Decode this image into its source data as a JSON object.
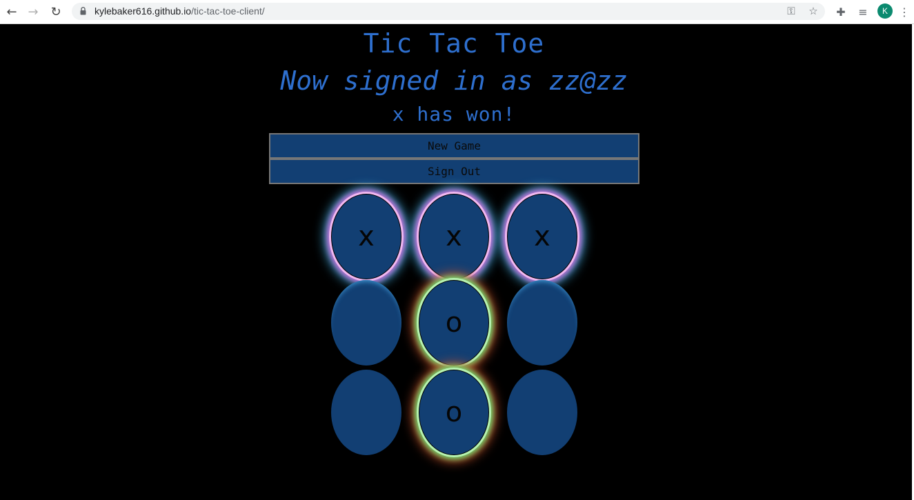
{
  "browser": {
    "url_host": "kylebaker616.github.io",
    "url_path": "/tic-tac-toe-client/",
    "avatar_letter": "K",
    "icons": [
      "back-icon",
      "forward-icon",
      "reload-icon",
      "lock-icon",
      "key-icon",
      "star-icon",
      "extensions-icon",
      "media-icon",
      "menu-icon"
    ]
  },
  "page": {
    "title": "Tic Tac Toe",
    "signed_in_text": "Now signed in as zz@zz",
    "status_text": "x has won!",
    "new_game_label": "New Game",
    "sign_out_label": "Sign Out"
  },
  "board": {
    "cells": [
      "x",
      "x",
      "x",
      "",
      "o",
      "",
      "",
      "o",
      ""
    ],
    "winner": "x",
    "colors": {
      "cell": "#123f73",
      "text": "#2e6fce",
      "x_glow": "#c86fd8",
      "o_glow": "#6fd86f"
    }
  }
}
